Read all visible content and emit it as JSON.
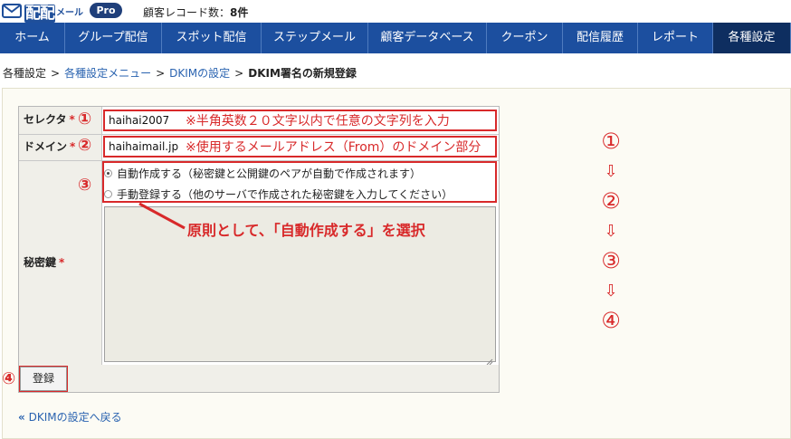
{
  "header": {
    "logo_text": "配配",
    "logo_sub": "メール",
    "pro_badge": "Pro",
    "record_label": "顧客レコード数：",
    "record_count": "8件"
  },
  "nav": {
    "items": [
      {
        "label": "ホーム"
      },
      {
        "label": "グループ配信"
      },
      {
        "label": "スポット配信"
      },
      {
        "label": "ステップメール"
      },
      {
        "label": "顧客データベース"
      },
      {
        "label": "クーポン"
      },
      {
        "label": "配信履歴"
      },
      {
        "label": "レポート"
      },
      {
        "label": "各種設定",
        "active": true
      }
    ]
  },
  "breadcrumb": {
    "items": [
      "各種設定",
      "各種設定メニュー",
      "DKIMの設定",
      "DKIM署名の新規登録"
    ],
    "separator": ">"
  },
  "form": {
    "selector_label": "セレクタ",
    "selector_value": "haihai2007",
    "selector_note": "※半角英数２０文字以内で任意の文字列を入力",
    "domain_label": "ドメイン",
    "domain_value": "haihaimail.jp",
    "domain_note": "※使用するメールアドレス（From）のドメイン部分",
    "required_mark": "*",
    "privkey_label": "秘密鍵",
    "radio_auto": "自動作成する（秘密鍵と公開鍵のペアが自動で作成されます）",
    "radio_manual": "手動登録する（他のサーバで作成された秘密鍵を入力してください）",
    "private_key_value": "",
    "submit_label": "登録"
  },
  "annotations": {
    "circle1": "①",
    "circle2": "②",
    "circle3": "③",
    "circle4": "④",
    "callout": "原則として、「自動作成する」を選択",
    "arrow": "⇩"
  },
  "back_link": {
    "icon": "«",
    "label": "DKIMの設定へ戻る"
  },
  "colors": {
    "nav_bg": "#1c4f9f",
    "nav_active": "#0e2e60",
    "accent_red": "#d8292a",
    "link": "#2a63b0"
  }
}
